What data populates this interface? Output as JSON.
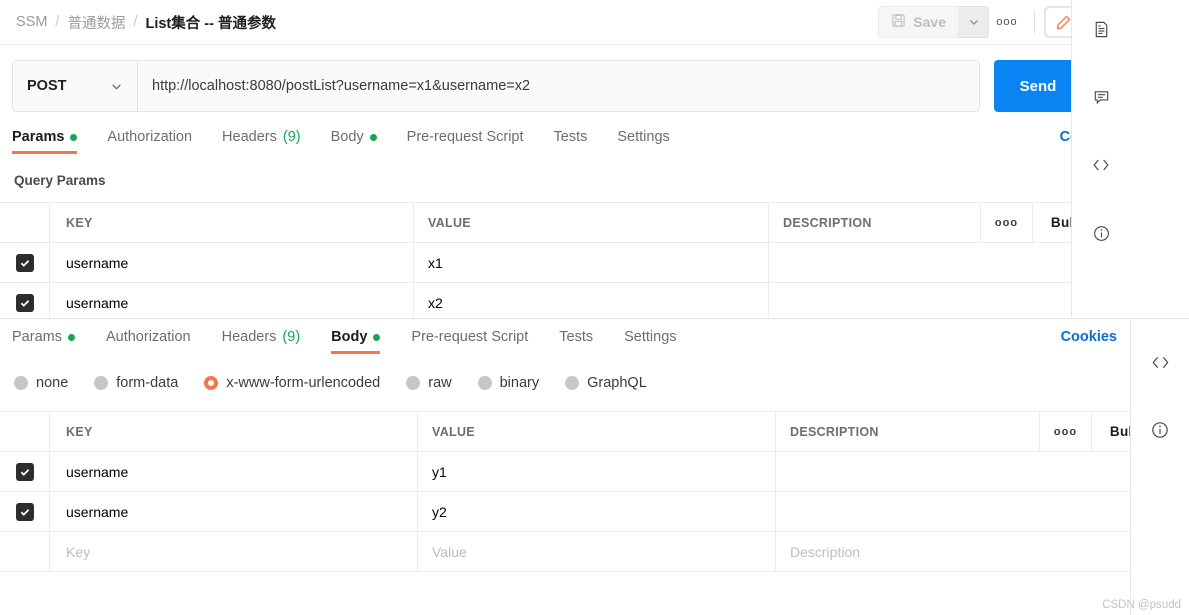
{
  "sectionA": {
    "breadcrumb": {
      "root": "SSM",
      "sep": "/",
      "folder": "普通数据",
      "current": "List集合 -- 普通参数"
    },
    "toolbar": {
      "save_label": "Save",
      "more_label": "ooo"
    },
    "request": {
      "method": "POST",
      "url": "http://localhost:8080/postList?username=x1&username=x2",
      "send_label": "Send"
    },
    "tabs": [
      {
        "label": "Params",
        "dot": true,
        "active": true
      },
      {
        "label": "Authorization",
        "dot": false,
        "active": false
      },
      {
        "label": "Headers",
        "count": "(9)",
        "active": false
      },
      {
        "label": "Body",
        "dot": true,
        "active": false
      },
      {
        "label": "Pre-request Script",
        "active": false
      },
      {
        "label": "Tests",
        "active": false
      },
      {
        "label": "Settings",
        "active": false
      }
    ],
    "cookies_label": "Cookies",
    "section_label": "Query Params",
    "table": {
      "headers": {
        "key": "KEY",
        "value": "VALUE",
        "description": "DESCRIPTION"
      },
      "dots_label": "ooo",
      "bulk_edit_label": "Bulk Edit",
      "rows": [
        {
          "checked": true,
          "key": "username",
          "value": "x1",
          "description": ""
        },
        {
          "checked": true,
          "key": "username",
          "value": "x2",
          "description": ""
        }
      ]
    }
  },
  "sectionB": {
    "tabs": [
      {
        "label": "Params",
        "dot": true,
        "active": false
      },
      {
        "label": "Authorization",
        "dot": false,
        "active": false
      },
      {
        "label": "Headers",
        "count": "(9)",
        "active": false
      },
      {
        "label": "Body",
        "dot": true,
        "active": true
      },
      {
        "label": "Pre-request Script",
        "active": false
      },
      {
        "label": "Tests",
        "active": false
      },
      {
        "label": "Settings",
        "active": false
      }
    ],
    "cookies_label": "Cookies",
    "body_types": [
      {
        "label": "none",
        "selected": false
      },
      {
        "label": "form-data",
        "selected": false
      },
      {
        "label": "x-www-form-urlencoded",
        "selected": true
      },
      {
        "label": "raw",
        "selected": false
      },
      {
        "label": "binary",
        "selected": false
      },
      {
        "label": "GraphQL",
        "selected": false
      }
    ],
    "table": {
      "headers": {
        "key": "KEY",
        "value": "VALUE",
        "description": "DESCRIPTION"
      },
      "dots_label": "ooo",
      "bulk_edit_label": "Bulk Edit",
      "rows": [
        {
          "checked": true,
          "key": "username",
          "value": "y1",
          "description": ""
        },
        {
          "checked": true,
          "key": "username",
          "value": "y2",
          "description": ""
        }
      ],
      "empty_row": {
        "key_placeholder": "Key",
        "value_placeholder": "Value",
        "description_placeholder": "Description"
      }
    }
  },
  "colors": {
    "accent_orange": "#f4764a",
    "send_blue": "#0b84f3",
    "link_blue": "#0b6ed1",
    "dot_green": "#19a356",
    "checkbox_dark": "#2d2d2d"
  },
  "watermark": "CSDN @psudd"
}
